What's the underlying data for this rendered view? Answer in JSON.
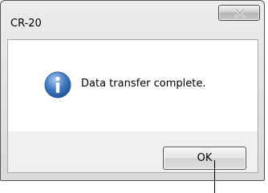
{
  "window": {
    "title": "CR-20"
  },
  "titlebar": {
    "close_icon": "close-x-icon"
  },
  "dialog": {
    "icon": "information-icon",
    "message": "Data transfer complete.",
    "ok_label": "OK"
  },
  "colors": {
    "info_icon_blue": "#1f5aa6",
    "titlebar_gray": "#dcdcdc",
    "close_button_glyph": "#ffffff"
  }
}
